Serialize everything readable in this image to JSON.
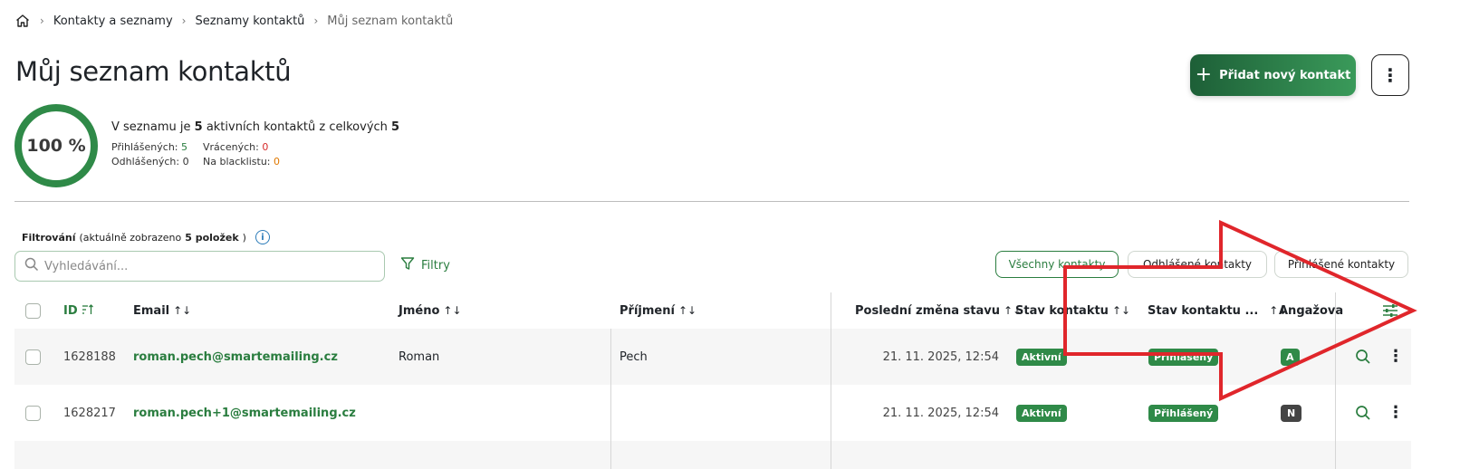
{
  "breadcrumb": {
    "home_icon": "home-icon",
    "items": [
      "Kontakty a seznamy",
      "Seznamy kontaktů",
      "Můj seznam kontaktů"
    ]
  },
  "page": {
    "title": "Můj seznam kontaktů",
    "add_button": "Přidat nový kontakt"
  },
  "summary": {
    "percent": "100 %",
    "line_prefix": "V seznamu je",
    "active_count": "5",
    "line_middle": "aktivních kontaktů z celkových",
    "total_count": "5",
    "subscribed_label": "Přihlášených:",
    "subscribed_value": "5",
    "bounced_label": "Vrácených:",
    "bounced_value": "0",
    "unsubscribed_label": "Odhlášených:",
    "unsubscribed_value": "0",
    "blacklist_label": "Na blacklistu:",
    "blacklist_value": "0"
  },
  "filter": {
    "label": "Filtrování",
    "shown_prefix": "(aktuálně zobrazeno",
    "shown_count": "5 položek",
    "shown_suffix": ")",
    "search_placeholder": "Vyhledávání...",
    "filters_button": "Filtry",
    "segments": [
      "Všechny kontakty",
      "Odhlášené kontakty",
      "Přihlášené kontakty"
    ]
  },
  "table": {
    "columns": {
      "id": "ID",
      "email": "Email",
      "name": "Jméno",
      "surname": "Příjmení",
      "last_change": "Poslední změna stavu",
      "status": "Stav kontaktu",
      "status2": "Stav kontaktu ...",
      "engagement": "Angažovanost"
    },
    "sort_glyph": "↑↓",
    "rows": [
      {
        "id": "1628188",
        "email": "roman.pech@smartemailing.cz",
        "name": "Roman",
        "surname": "Pech",
        "last_change": "21. 11. 2025, 12:54",
        "status": "Aktivní",
        "status2": "Přihlášený",
        "engagement": "A"
      },
      {
        "id": "1628217",
        "email": "roman.pech+1@smartemailing.cz",
        "name": "",
        "surname": "",
        "last_change": "21. 11. 2025, 12:54",
        "status": "Aktivní",
        "status2": "Přihlášený",
        "engagement": "N"
      }
    ]
  },
  "colors": {
    "brand_green": "#2a7d3f",
    "annotation_red": "#e0262b"
  }
}
